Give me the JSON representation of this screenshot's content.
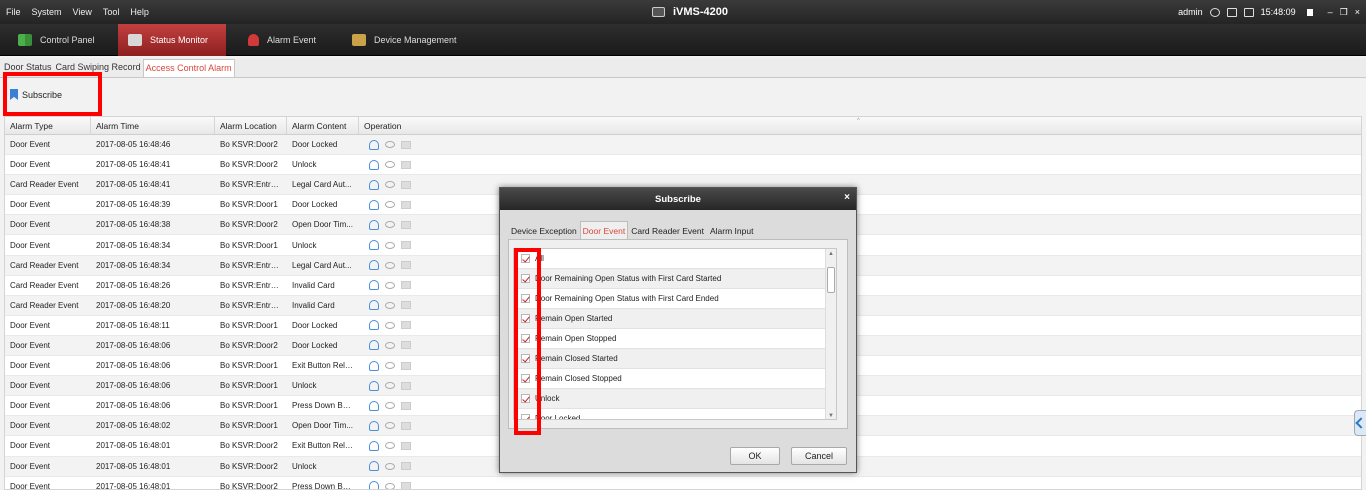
{
  "menu": [
    "File",
    "System",
    "View",
    "Tool",
    "Help"
  ],
  "app_title": "iVMS-4200",
  "system": {
    "user": "admin",
    "time": "15:48:09"
  },
  "modules": [
    {
      "label": "Control Panel",
      "active": false
    },
    {
      "label": "Status Monitor",
      "active": true
    },
    {
      "label": "Alarm Event",
      "active": false
    },
    {
      "label": "Device Management",
      "active": false
    }
  ],
  "subtabs": [
    "Door Status",
    "Card Swiping Record",
    "Access Control Alarm"
  ],
  "toolbar": {
    "subscribe_label": "Subscribe"
  },
  "table": {
    "headers": [
      "Alarm Type",
      "Alarm Time",
      "Alarm Location",
      "Alarm Content",
      "Operation"
    ],
    "rows": [
      [
        "Door Event",
        "2017-08-05 16:48:46",
        "Bo KSVR:Door2",
        "Door Locked"
      ],
      [
        "Door Event",
        "2017-08-05 16:48:41",
        "Bo KSVR:Door2",
        "Unlock"
      ],
      [
        "Card Reader Event",
        "2017-08-05 16:48:41",
        "Bo KSVR:Entran...",
        "Legal Card Aut..."
      ],
      [
        "Door Event",
        "2017-08-05 16:48:39",
        "Bo KSVR:Door1",
        "Door Locked"
      ],
      [
        "Door Event",
        "2017-08-05 16:48:38",
        "Bo KSVR:Door2",
        "Open Door Tim..."
      ],
      [
        "Door Event",
        "2017-08-05 16:48:34",
        "Bo KSVR:Door1",
        "Unlock"
      ],
      [
        "Card Reader Event",
        "2017-08-05 16:48:34",
        "Bo KSVR:Entran...",
        "Legal Card Aut..."
      ],
      [
        "Card Reader Event",
        "2017-08-05 16:48:26",
        "Bo KSVR:Entran...",
        "Invalid Card"
      ],
      [
        "Card Reader Event",
        "2017-08-05 16:48:20",
        "Bo KSVR:Entran...",
        "Invalid Card"
      ],
      [
        "Door Event",
        "2017-08-05 16:48:11",
        "Bo KSVR:Door1",
        "Door Locked"
      ],
      [
        "Door Event",
        "2017-08-05 16:48:06",
        "Bo KSVR:Door2",
        "Door Locked"
      ],
      [
        "Door Event",
        "2017-08-05 16:48:06",
        "Bo KSVR:Door1",
        "Exit Button Rele..."
      ],
      [
        "Door Event",
        "2017-08-05 16:48:06",
        "Bo KSVR:Door1",
        "Unlock"
      ],
      [
        "Door Event",
        "2017-08-05 16:48:06",
        "Bo KSVR:Door1",
        "Press Down But..."
      ],
      [
        "Door Event",
        "2017-08-05 16:48:02",
        "Bo KSVR:Door1",
        "Open Door Tim..."
      ],
      [
        "Door Event",
        "2017-08-05 16:48:01",
        "Bo KSVR:Door2",
        "Exit Button Rele..."
      ],
      [
        "Door Event",
        "2017-08-05 16:48:01",
        "Bo KSVR:Door2",
        "Unlock"
      ],
      [
        "Door Event",
        "2017-08-05 16:48:01",
        "Bo KSVR:Door2",
        "Press Down But..."
      ]
    ]
  },
  "dialog": {
    "title": "Subscribe",
    "close": "×",
    "tabs": [
      "Device Exception",
      "Door Event",
      "Card Reader Event",
      "Alarm Input"
    ],
    "active_tab": 1,
    "items": [
      "All",
      "Door Remaining Open Status with First Card Started",
      "Door Remaining Open Status with First Card Ended",
      "Remain Open Started",
      "Remain Open Stopped",
      "Remain Closed Started",
      "Remain Closed Stopped",
      "Unlock",
      "Door Locked"
    ],
    "ok_label": "OK",
    "cancel_label": "Cancel"
  },
  "colors": {
    "accent": "#d9463a",
    "highlight": "#ff0000",
    "active_module": "#b83535"
  }
}
